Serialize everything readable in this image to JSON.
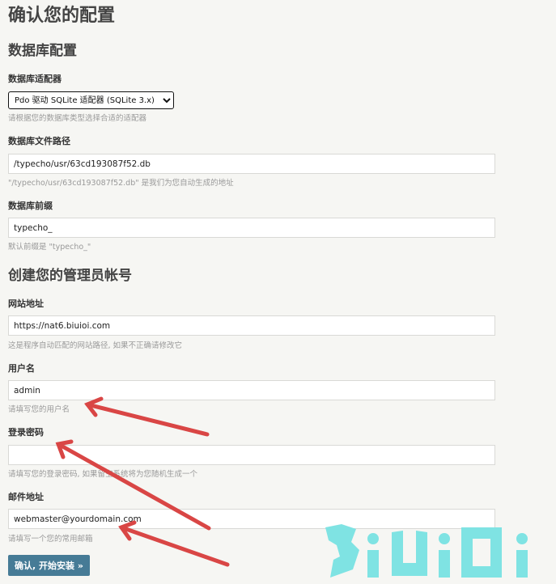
{
  "page": {
    "title": "确认您的配置"
  },
  "database": {
    "section_title": "数据库配置",
    "adapter": {
      "label": "数据库适配器",
      "selected": "Pdo 驱动 SQLite 适配器 (SQLite 3.x)",
      "description": "请根据您的数据库类型选择合适的适配器"
    },
    "file_path": {
      "label": "数据库文件路径",
      "value": "/typecho/usr/63cd193087f52.db",
      "description": "\"/typecho/usr/63cd193087f52.db\" 是我们为您自动生成的地址"
    },
    "prefix": {
      "label": "数据库前缀",
      "value": "typecho_",
      "description": "默认前缀是 \"typecho_\""
    }
  },
  "admin": {
    "section_title": "创建您的管理员帐号",
    "site_url": {
      "label": "网站地址",
      "value": "https://nat6.biuioi.com",
      "description": "这是程序自动匹配的网站路径, 如果不正确请修改它"
    },
    "username": {
      "label": "用户名",
      "value": "admin",
      "description": "请填写您的用户名"
    },
    "password": {
      "label": "登录密码",
      "value": "",
      "description": "请填写您的登录密码, 如果留空系统将为您随机生成一个"
    },
    "email": {
      "label": "邮件地址",
      "value": "webmaster@yourdomain.com",
      "description": "请填写一个您的常用邮箱"
    }
  },
  "actions": {
    "submit_label": "确认, 开始安装 »"
  },
  "watermark": {
    "text": "BiUiOi"
  },
  "colors": {
    "background": "#f6f6f3",
    "button": "#467b96",
    "arrow": "#d94645",
    "watermark": "#7fe3e3"
  },
  "icons": {
    "annotation": "red-arrow-icon"
  }
}
